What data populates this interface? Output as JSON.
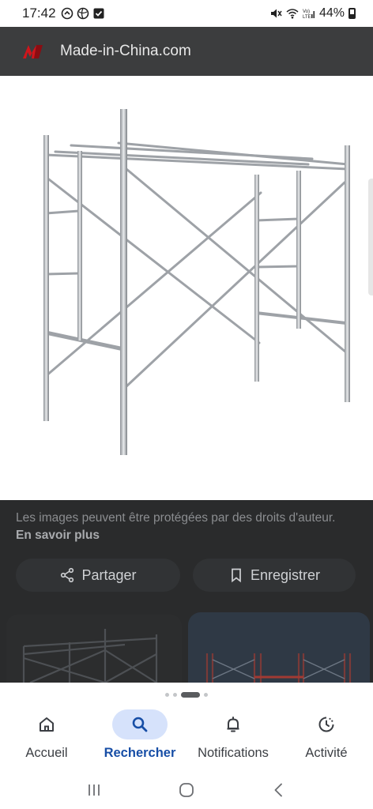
{
  "status_bar": {
    "time": "17:42",
    "battery": "44%"
  },
  "app_bar": {
    "site_name": "Made-in-China.com",
    "logo": "made-in-china-logo"
  },
  "image": {
    "subject": "scaffolding-frame"
  },
  "notice": {
    "text": "Les images peuvent être protégées par des droits d'auteur.",
    "link": "En savoir plus"
  },
  "actions": {
    "share_label": "Partager",
    "save_label": "Enregistrer"
  },
  "nav": [
    {
      "label": "Accueil",
      "icon": "home-icon",
      "active": false
    },
    {
      "label": "Rechercher",
      "icon": "search-icon",
      "active": true
    },
    {
      "label": "Notifications",
      "icon": "bell-icon",
      "active": false
    },
    {
      "label": "Activité",
      "icon": "activity-icon",
      "active": false
    }
  ],
  "colors": {
    "accent": "#174ea6",
    "active_pill": "#d6e2fb",
    "dark_bg": "#2a2b2c",
    "logo_red": "#d0151b"
  }
}
